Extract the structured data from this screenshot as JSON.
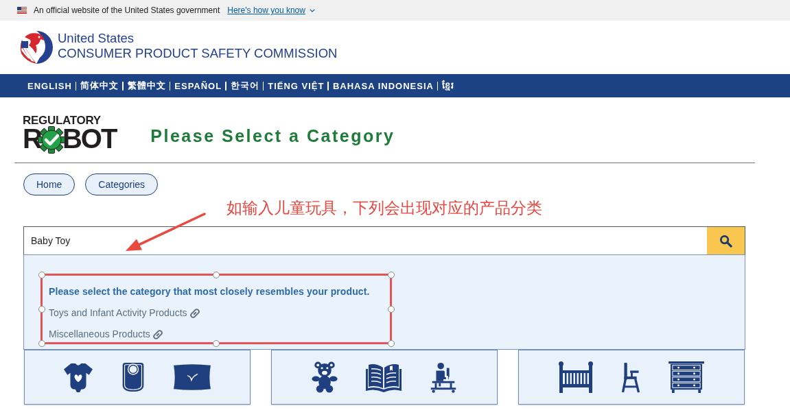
{
  "gov_banner": {
    "text": "An official website of the United States government",
    "link": "Here's how you know"
  },
  "header": {
    "agency_line_1": "United States",
    "agency_line_2": "CONSUMER PRODUCT SAFETY COMMISSION"
  },
  "language_bar": {
    "languages": [
      {
        "label": "ENGLISH"
      },
      {
        "label": "简体中文"
      },
      {
        "label": "繁體中文"
      },
      {
        "label": "ESPAÑOL"
      },
      {
        "label": "한국어"
      },
      {
        "label": "TIẾNG VIỆT"
      },
      {
        "label": "BAHASA INDONESIA"
      },
      {
        "label": "ខ្មែរ"
      }
    ]
  },
  "tool_logo": {
    "top_line": "REGULATORY",
    "bottom_start": "R",
    "bottom_end": "BOT"
  },
  "title": "Please Select a Category",
  "breadcrumbs": [
    {
      "label": "Home"
    },
    {
      "label": "Categories"
    }
  ],
  "annotation": {
    "text": "如输入儿童玩具，下列会出现对应的产品分类"
  },
  "search": {
    "value": "Baby Toy"
  },
  "suggestions": {
    "heading": "Please select the category that most closely resembles your product.",
    "items": [
      {
        "label": "Toys and Infant Activity Products"
      },
      {
        "label": "Miscellaneous Products"
      }
    ]
  }
}
